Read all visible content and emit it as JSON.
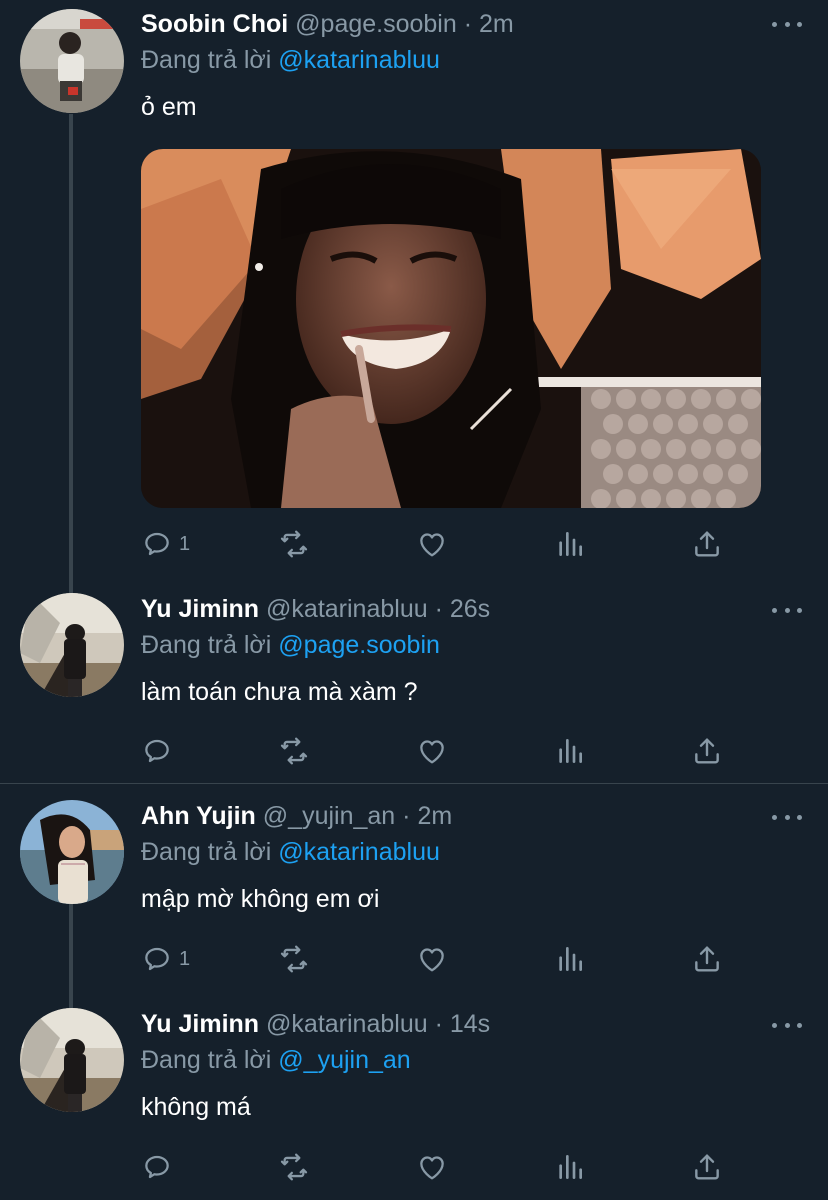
{
  "theme": {
    "background": "#15202b",
    "text": "#ffffff",
    "secondary": "#8899a6",
    "link": "#1da1f2",
    "line": "#38444d"
  },
  "tweets": [
    {
      "name": "Soobin Choi",
      "handle": "@page.soobin",
      "dot": "·",
      "time": "2m",
      "reply_prefix": "Đang trả lời",
      "reply_to": "@katarinabluu",
      "text": "ỏ em",
      "has_media": true,
      "media_description_icon": "photo-icon",
      "reply_count": "1"
    },
    {
      "name": "Yu Jiminn",
      "handle": "@katarinabluu",
      "dot": "·",
      "time": "26s",
      "reply_prefix": "Đang trả lời",
      "reply_to": "@page.soobin",
      "text": "làm toán chưa mà xàm ?",
      "reply_count": ""
    },
    {
      "name": "Ahn Yujin",
      "handle": "@_yujin_an",
      "dot": "·",
      "time": "2m",
      "reply_prefix": "Đang trả lời",
      "reply_to": "@katarinabluu",
      "text": "mập mờ không em ơi",
      "reply_count": "1"
    },
    {
      "name": "Yu Jiminn",
      "handle": "@katarinabluu",
      "dot": "·",
      "time": "14s",
      "reply_prefix": "Đang trả lời",
      "reply_to": "@_yujin_an",
      "text": "không má",
      "reply_count": ""
    }
  ],
  "icons": {
    "reply": "reply-icon",
    "retweet": "retweet-icon",
    "like": "heart-icon",
    "analytics": "analytics-icon",
    "share": "share-icon",
    "more": "more-icon"
  }
}
